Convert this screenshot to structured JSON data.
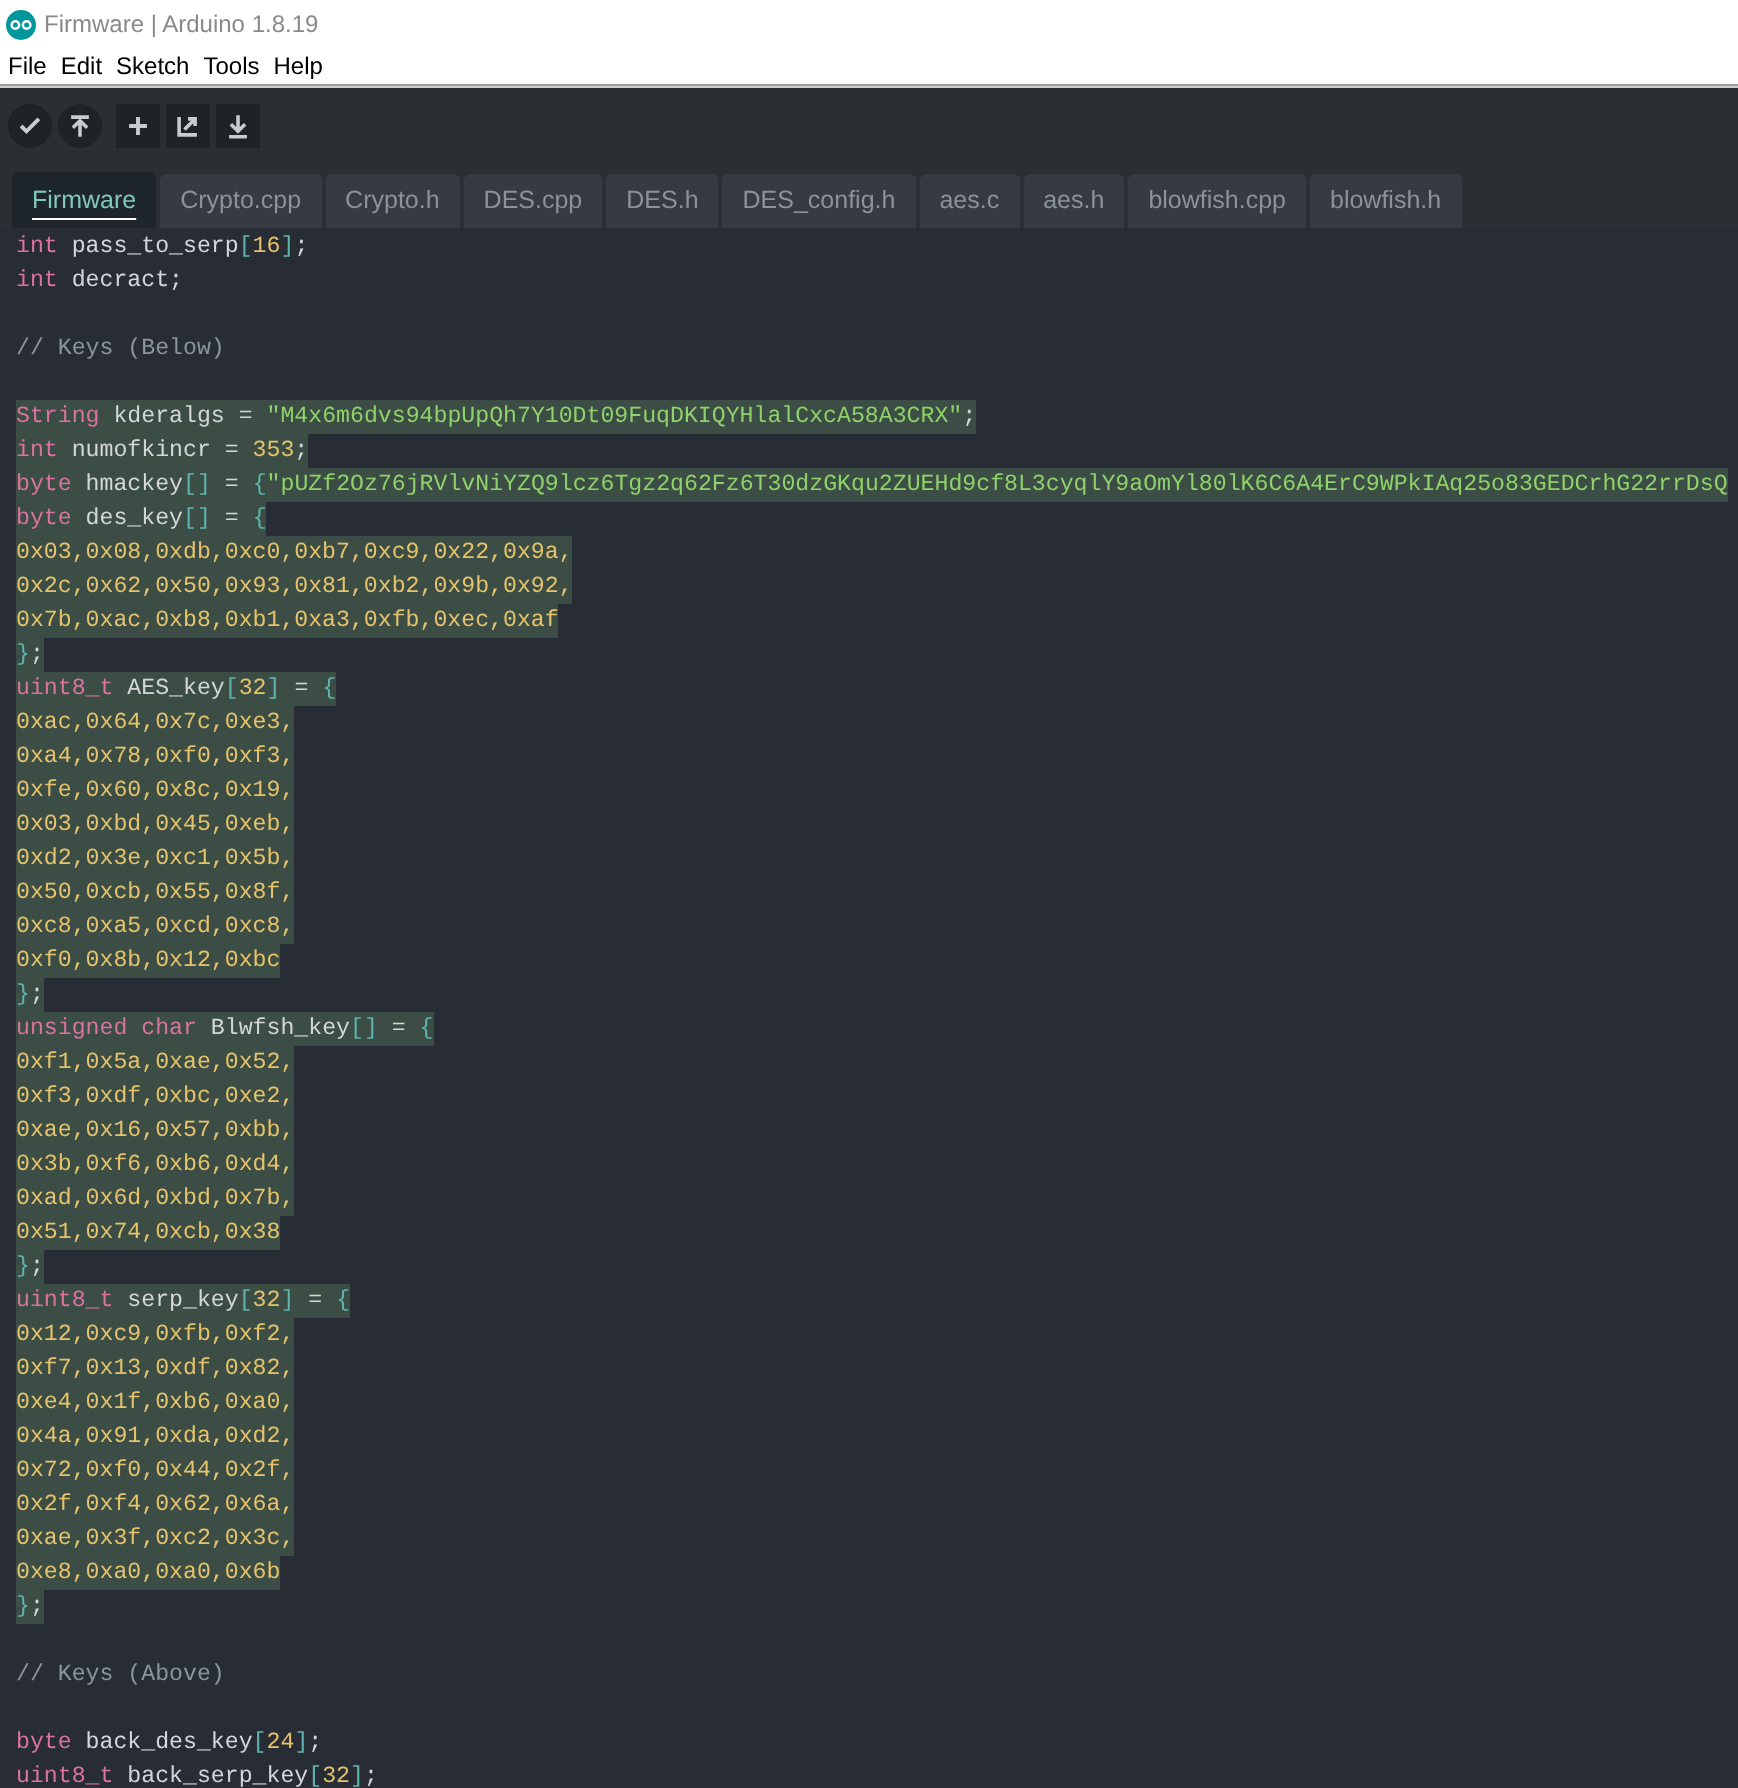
{
  "window": {
    "title": "Firmware | Arduino 1.8.19"
  },
  "menu": [
    "File",
    "Edit",
    "Sketch",
    "Tools",
    "Help"
  ],
  "toolbar": [
    {
      "kind": "verify"
    },
    {
      "kind": "upload"
    },
    {
      "kind": "new"
    },
    {
      "kind": "open"
    },
    {
      "kind": "save"
    }
  ],
  "tabs": [
    {
      "label": "Firmware",
      "selected": true
    },
    {
      "label": "Crypto.cpp",
      "selected": false
    },
    {
      "label": "Crypto.h",
      "selected": false
    },
    {
      "label": "DES.cpp",
      "selected": false
    },
    {
      "label": "DES.h",
      "selected": false
    },
    {
      "label": "DES_config.h",
      "selected": false
    },
    {
      "label": "aes.c",
      "selected": false
    },
    {
      "label": "aes.h",
      "selected": false
    },
    {
      "label": "blowfish.cpp",
      "selected": false
    },
    {
      "label": "blowfish.h",
      "selected": false
    }
  ],
  "editor": {
    "lines": [
      {
        "kind": "code",
        "highlighted": false,
        "tokens": [
          {
            "kind": "type",
            "text": "int"
          },
          {
            "kind": "plain",
            "text": " pass_to_serp"
          },
          {
            "kind": "punct",
            "text": "["
          },
          {
            "kind": "number",
            "text": "16"
          },
          {
            "kind": "punct",
            "text": "]"
          },
          {
            "kind": "plain",
            "text": ";"
          }
        ]
      },
      {
        "kind": "code",
        "highlighted": false,
        "tokens": [
          {
            "kind": "type",
            "text": "int"
          },
          {
            "kind": "plain",
            "text": " decract;"
          }
        ]
      },
      {
        "kind": "blank"
      },
      {
        "kind": "code",
        "highlighted": false,
        "tokens": [
          {
            "kind": "comment",
            "text": "// Keys (Below)"
          }
        ]
      },
      {
        "kind": "blank"
      },
      {
        "kind": "code",
        "highlighted": true,
        "tokens": [
          {
            "kind": "type",
            "text": "String"
          },
          {
            "kind": "plain",
            "text": " kderalgs = "
          },
          {
            "kind": "string",
            "text": "\"M4x6m6dvs94bpUpQh7Y10Dt09FuqDKIQYHlalCxcA58A3CRX\""
          },
          {
            "kind": "plain",
            "text": ";"
          }
        ]
      },
      {
        "kind": "code",
        "highlighted": true,
        "tokens": [
          {
            "kind": "type",
            "text": "int"
          },
          {
            "kind": "plain",
            "text": " numofkincr = "
          },
          {
            "kind": "number",
            "text": "353"
          },
          {
            "kind": "plain",
            "text": ";"
          }
        ]
      },
      {
        "kind": "code",
        "highlighted": true,
        "tokens": [
          {
            "kind": "type",
            "text": "byte"
          },
          {
            "kind": "plain",
            "text": " hmackey"
          },
          {
            "kind": "punct",
            "text": "[]"
          },
          {
            "kind": "plain",
            "text": " = "
          },
          {
            "kind": "punct",
            "text": "{"
          },
          {
            "kind": "string",
            "text": "\"pUZf2Oz76jRVlvNiYZQ9lcz6Tgz2q62Fz6T30dzGKqu2ZUEHd9cf8L3cyqlY9aOmYl80lK6C6A4ErC9WPkIAq25o83GEDCrhG22rrDsQ"
          }
        ]
      },
      {
        "kind": "code",
        "highlighted": true,
        "tokens": [
          {
            "kind": "type",
            "text": "byte"
          },
          {
            "kind": "plain",
            "text": " des_key"
          },
          {
            "kind": "punct",
            "text": "[]"
          },
          {
            "kind": "plain",
            "text": " = "
          },
          {
            "kind": "punct",
            "text": "{"
          }
        ]
      },
      {
        "kind": "code",
        "highlighted": true,
        "tokens": [
          {
            "kind": "number",
            "text": "0x03,0x08,0xdb,0xc0,0xb7,0xc9,0x22,0x9a,"
          }
        ]
      },
      {
        "kind": "code",
        "highlighted": true,
        "tokens": [
          {
            "kind": "number",
            "text": "0x2c,0x62,0x50,0x93,0x81,0xb2,0x9b,0x92,"
          }
        ]
      },
      {
        "kind": "code",
        "highlighted": true,
        "tokens": [
          {
            "kind": "number",
            "text": "0x7b,0xac,0xb8,0xb1,0xa3,0xfb,0xec,0xaf"
          }
        ]
      },
      {
        "kind": "code",
        "highlighted": true,
        "tokens": [
          {
            "kind": "punct",
            "text": "}"
          },
          {
            "kind": "plain",
            "text": ";"
          }
        ]
      },
      {
        "kind": "code",
        "highlighted": true,
        "tokens": [
          {
            "kind": "type",
            "text": "uint8_t"
          },
          {
            "kind": "plain",
            "text": " AES_key"
          },
          {
            "kind": "punct",
            "text": "["
          },
          {
            "kind": "number",
            "text": "32"
          },
          {
            "kind": "punct",
            "text": "]"
          },
          {
            "kind": "plain",
            "text": " = "
          },
          {
            "kind": "punct",
            "text": "{"
          }
        ]
      },
      {
        "kind": "code",
        "highlighted": true,
        "tokens": [
          {
            "kind": "number",
            "text": "0xac,0x64,0x7c,0xe3,"
          }
        ]
      },
      {
        "kind": "code",
        "highlighted": true,
        "tokens": [
          {
            "kind": "number",
            "text": "0xa4,0x78,0xf0,0xf3,"
          }
        ]
      },
      {
        "kind": "code",
        "highlighted": true,
        "tokens": [
          {
            "kind": "number",
            "text": "0xfe,0x60,0x8c,0x19,"
          }
        ]
      },
      {
        "kind": "code",
        "highlighted": true,
        "tokens": [
          {
            "kind": "number",
            "text": "0x03,0xbd,0x45,0xeb,"
          }
        ]
      },
      {
        "kind": "code",
        "highlighted": true,
        "tokens": [
          {
            "kind": "number",
            "text": "0xd2,0x3e,0xc1,0x5b,"
          }
        ]
      },
      {
        "kind": "code",
        "highlighted": true,
        "tokens": [
          {
            "kind": "number",
            "text": "0x50,0xcb,0x55,0x8f,"
          }
        ]
      },
      {
        "kind": "code",
        "highlighted": true,
        "tokens": [
          {
            "kind": "number",
            "text": "0xc8,0xa5,0xcd,0xc8,"
          }
        ]
      },
      {
        "kind": "code",
        "highlighted": true,
        "tokens": [
          {
            "kind": "number",
            "text": "0xf0,0x8b,0x12,0xbc"
          }
        ]
      },
      {
        "kind": "code",
        "highlighted": true,
        "tokens": [
          {
            "kind": "punct",
            "text": "}"
          },
          {
            "kind": "plain",
            "text": ";"
          }
        ]
      },
      {
        "kind": "code",
        "highlighted": true,
        "tokens": [
          {
            "kind": "type",
            "text": "unsigned char"
          },
          {
            "kind": "plain",
            "text": " Blwfsh_key"
          },
          {
            "kind": "punct",
            "text": "[]"
          },
          {
            "kind": "plain",
            "text": " = "
          },
          {
            "kind": "punct",
            "text": "{"
          }
        ]
      },
      {
        "kind": "code",
        "highlighted": true,
        "tokens": [
          {
            "kind": "number",
            "text": "0xf1,0x5a,0xae,0x52,"
          }
        ]
      },
      {
        "kind": "code",
        "highlighted": true,
        "tokens": [
          {
            "kind": "number",
            "text": "0xf3,0xdf,0xbc,0xe2,"
          }
        ]
      },
      {
        "kind": "code",
        "highlighted": true,
        "tokens": [
          {
            "kind": "number",
            "text": "0xae,0x16,0x57,0xbb,"
          }
        ]
      },
      {
        "kind": "code",
        "highlighted": true,
        "tokens": [
          {
            "kind": "number",
            "text": "0x3b,0xf6,0xb6,0xd4,"
          }
        ]
      },
      {
        "kind": "code",
        "highlighted": true,
        "tokens": [
          {
            "kind": "number",
            "text": "0xad,0x6d,0xbd,0x7b,"
          }
        ]
      },
      {
        "kind": "code",
        "highlighted": true,
        "tokens": [
          {
            "kind": "number",
            "text": "0x51,0x74,0xcb,0x38"
          }
        ]
      },
      {
        "kind": "code",
        "highlighted": true,
        "tokens": [
          {
            "kind": "punct",
            "text": "}"
          },
          {
            "kind": "plain",
            "text": ";"
          }
        ]
      },
      {
        "kind": "code",
        "highlighted": true,
        "tokens": [
          {
            "kind": "type",
            "text": "uint8_t"
          },
          {
            "kind": "plain",
            "text": " serp_key"
          },
          {
            "kind": "punct",
            "text": "["
          },
          {
            "kind": "number",
            "text": "32"
          },
          {
            "kind": "punct",
            "text": "]"
          },
          {
            "kind": "plain",
            "text": " = "
          },
          {
            "kind": "punct",
            "text": "{"
          }
        ]
      },
      {
        "kind": "code",
        "highlighted": true,
        "tokens": [
          {
            "kind": "number",
            "text": "0x12,0xc9,0xfb,0xf2,"
          }
        ]
      },
      {
        "kind": "code",
        "highlighted": true,
        "tokens": [
          {
            "kind": "number",
            "text": "0xf7,0x13,0xdf,0x82,"
          }
        ]
      },
      {
        "kind": "code",
        "highlighted": true,
        "tokens": [
          {
            "kind": "number",
            "text": "0xe4,0x1f,0xb6,0xa0,"
          }
        ]
      },
      {
        "kind": "code",
        "highlighted": true,
        "tokens": [
          {
            "kind": "number",
            "text": "0x4a,0x91,0xda,0xd2,"
          }
        ]
      },
      {
        "kind": "code",
        "highlighted": true,
        "tokens": [
          {
            "kind": "number",
            "text": "0x72,0xf0,0x44,0x2f,"
          }
        ]
      },
      {
        "kind": "code",
        "highlighted": true,
        "tokens": [
          {
            "kind": "number",
            "text": "0x2f,0xf4,0x62,0x6a,"
          }
        ]
      },
      {
        "kind": "code",
        "highlighted": true,
        "tokens": [
          {
            "kind": "number",
            "text": "0xae,0x3f,0xc2,0x3c,"
          }
        ]
      },
      {
        "kind": "code",
        "highlighted": true,
        "tokens": [
          {
            "kind": "number",
            "text": "0xe8,0xa0,0xa0,0x6b"
          }
        ]
      },
      {
        "kind": "code",
        "highlighted": true,
        "tokens": [
          {
            "kind": "punct",
            "text": "}"
          },
          {
            "kind": "plain",
            "text": ";"
          }
        ]
      },
      {
        "kind": "blank"
      },
      {
        "kind": "code",
        "highlighted": false,
        "tokens": [
          {
            "kind": "comment",
            "text": "// Keys (Above)"
          }
        ]
      },
      {
        "kind": "blank"
      },
      {
        "kind": "code",
        "highlighted": false,
        "tokens": [
          {
            "kind": "type",
            "text": "byte"
          },
          {
            "kind": "plain",
            "text": " back_des_key"
          },
          {
            "kind": "punct",
            "text": "["
          },
          {
            "kind": "number",
            "text": "24"
          },
          {
            "kind": "punct",
            "text": "]"
          },
          {
            "kind": "plain",
            "text": ";"
          }
        ]
      },
      {
        "kind": "code",
        "highlighted": false,
        "tokens": [
          {
            "kind": "type",
            "text": "uint8_t"
          },
          {
            "kind": "plain",
            "text": " back_serp_key"
          },
          {
            "kind": "punct",
            "text": "["
          },
          {
            "kind": "number",
            "text": "32"
          },
          {
            "kind": "punct",
            "text": "]"
          },
          {
            "kind": "plain",
            "text": ";"
          }
        ]
      }
    ]
  }
}
